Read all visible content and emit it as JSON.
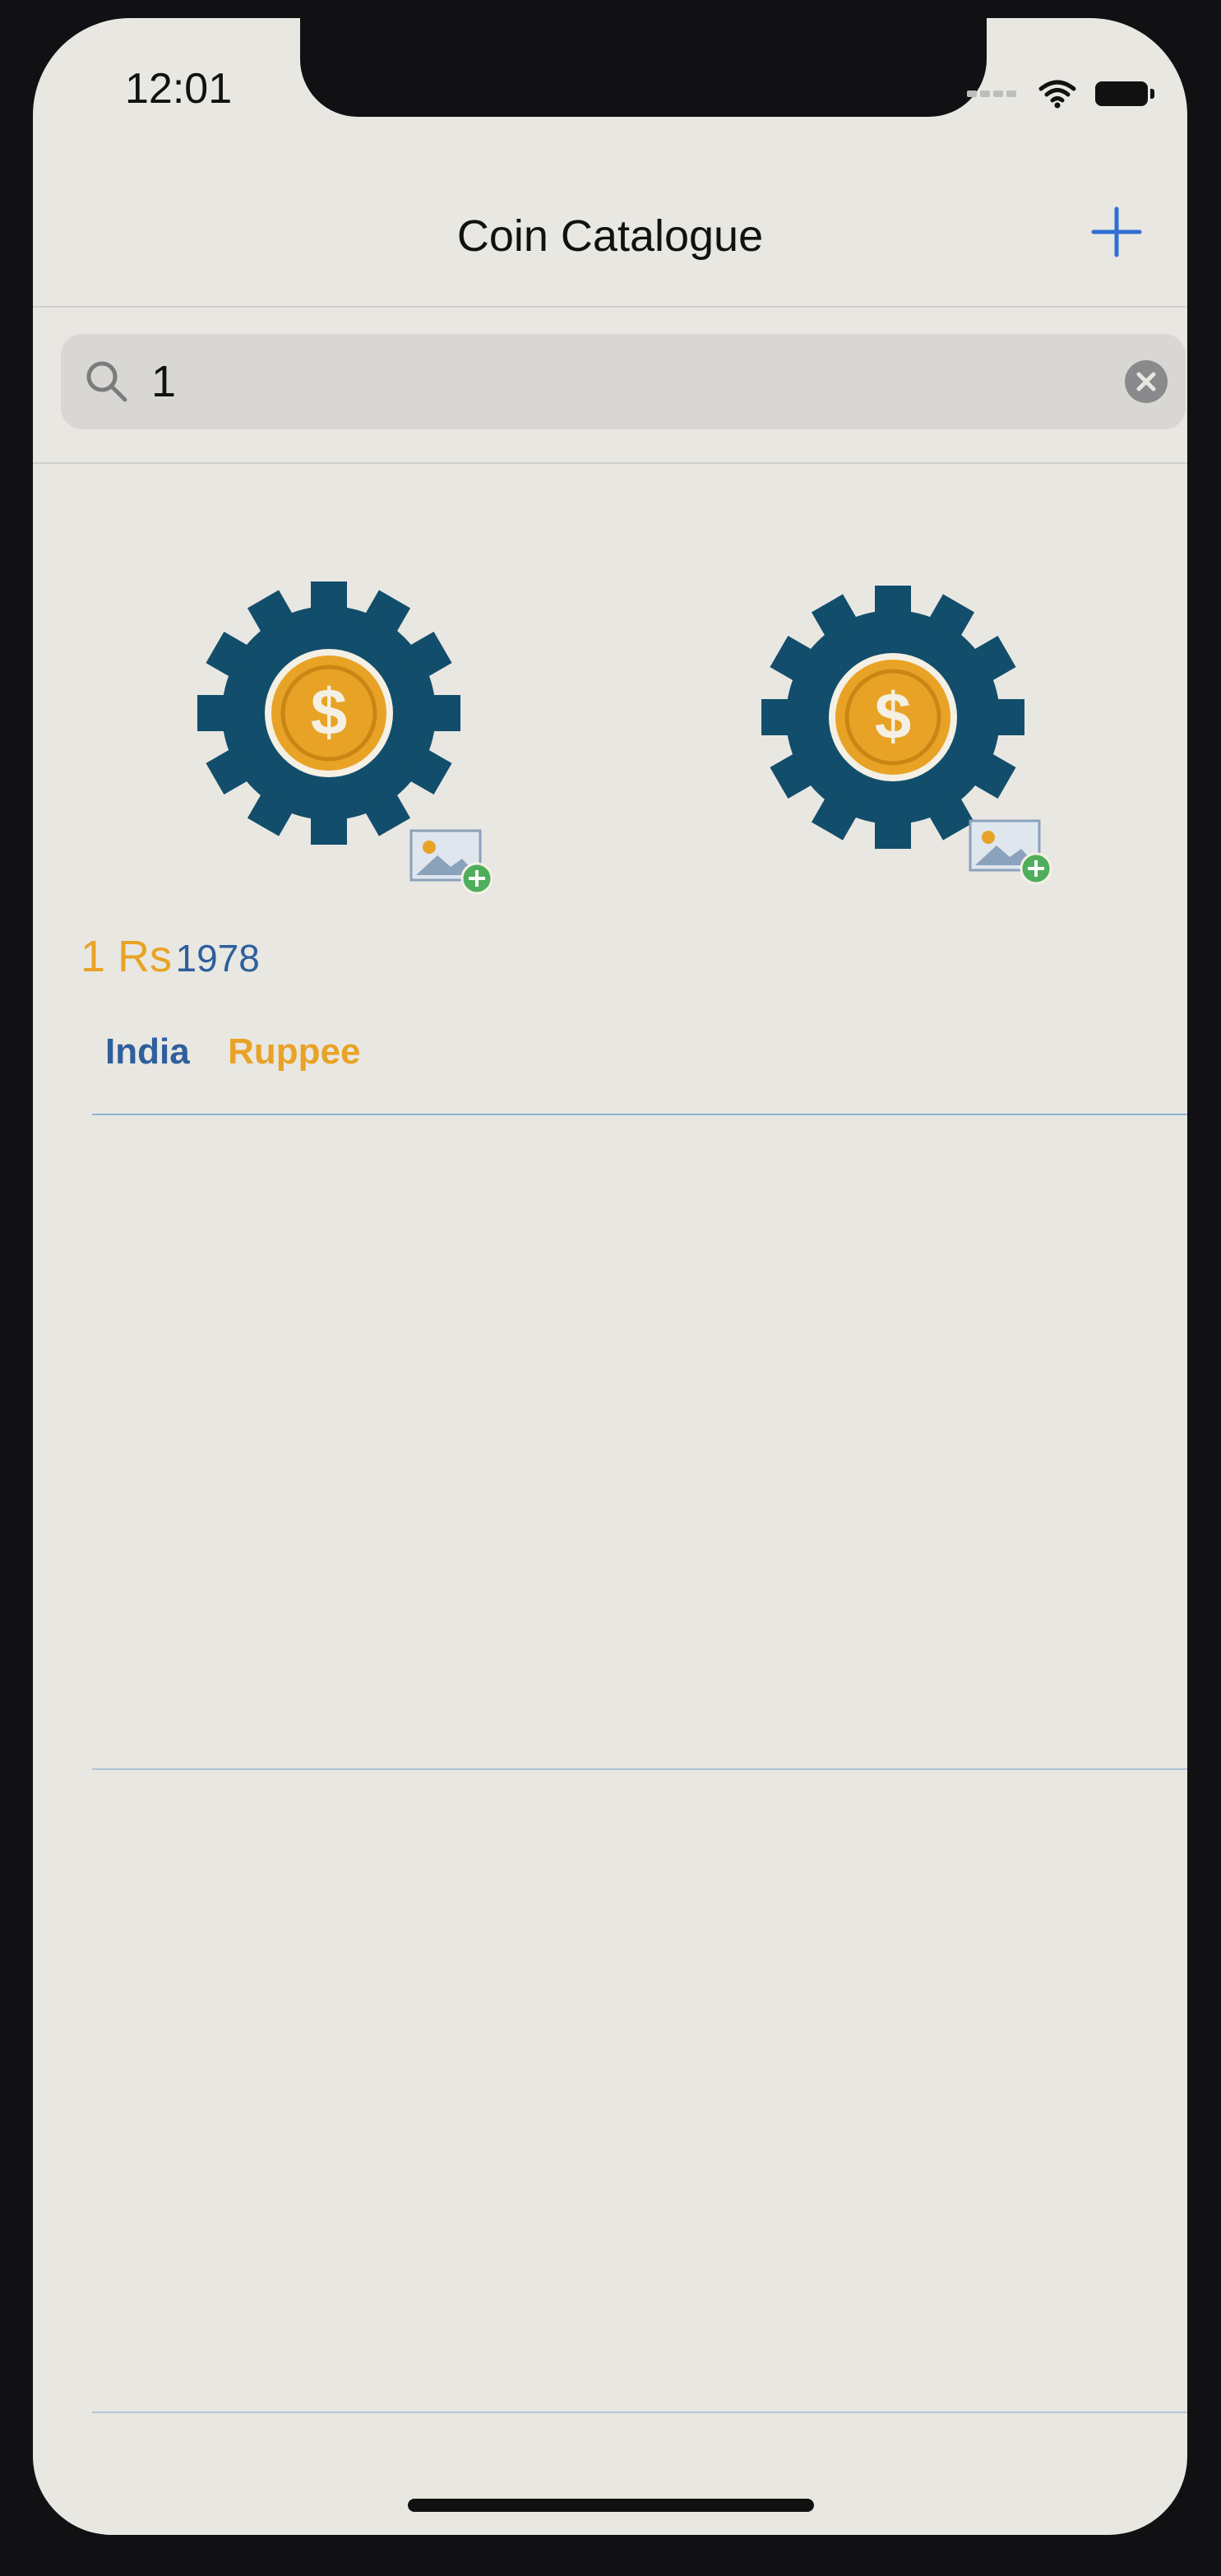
{
  "status_bar": {
    "time": "12:01"
  },
  "nav": {
    "title": "Coin Catalogue",
    "add_icon": "plus-icon"
  },
  "search": {
    "value": "1",
    "search_icon": "search-icon",
    "clear_icon": "clear-icon"
  },
  "results": [
    {
      "images": [
        "coin-placeholder-icon",
        "coin-placeholder-icon"
      ],
      "denomination": "1 Rs",
      "year": "1978",
      "country": "India",
      "currency": "Ruppee"
    }
  ],
  "colors": {
    "accent_blue": "#2e5f9c",
    "accent_orange": "#e8a326",
    "gear_dark": "#124e6b",
    "coin_gold": "#e8a326"
  }
}
